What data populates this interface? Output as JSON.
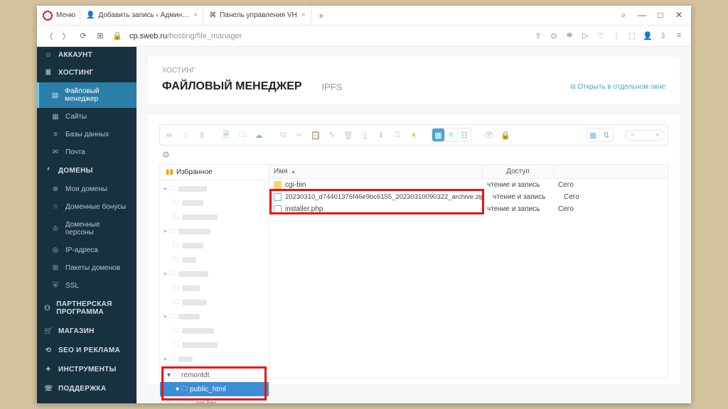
{
  "browser": {
    "menu": "Меню",
    "tabs": [
      {
        "label": "Добавить запись ‹ Админ…"
      },
      {
        "label": "Панель управления VH"
      }
    ],
    "url_host": "cp.sweb.ru",
    "url_path": "/hosting/file_manager"
  },
  "sidebar": {
    "account": "АККАУНТ",
    "hosting": "ХОСТИНГ",
    "items_hosting": [
      {
        "icon": "▤",
        "label": "Файловый менеджер",
        "active": true
      },
      {
        "icon": "▦",
        "label": "Сайты"
      },
      {
        "icon": "≡",
        "label": "Базы данных"
      },
      {
        "icon": "✉",
        "label": "Почта"
      }
    ],
    "domains": "ДОМЕНЫ",
    "items_domains": [
      {
        "icon": "⊕",
        "label": "Мои домены"
      },
      {
        "icon": "☆",
        "label": "Доменные бонусы"
      },
      {
        "icon": "♔",
        "label": "Доменные персоны"
      },
      {
        "icon": "◎",
        "label": "IP-адреса"
      },
      {
        "icon": "⊞",
        "label": "Пакеты доменов"
      },
      {
        "icon": "⛨",
        "label": "SSL"
      }
    ],
    "partner": "ПАРТНЕРСКАЯ ПРОГРАММА",
    "shop": "МАГАЗИН",
    "seo": "SEO И РЕКЛАМА",
    "tools": "ИНСТРУМЕНТЫ",
    "support": "ПОДДЕРЖКА"
  },
  "header": {
    "breadcrumb": "ХОСТИНГ",
    "title": "ФАЙЛОВЫЙ МЕНЕДЖЕР",
    "tab2": "IPFS",
    "open": "Открыть в отдельном окне"
  },
  "tree": {
    "favorites": "Избранное",
    "node_parent": "remontdt",
    "node_sel": "public_html",
    "node_child": "cgi-bin"
  },
  "table": {
    "col_name": "Имя",
    "col_access": "Доступ",
    "col_date": "",
    "rows": [
      {
        "type": "folder",
        "name": "cgi-bin",
        "access": "чтение и запись",
        "date": "Сего"
      },
      {
        "type": "file",
        "name": "20230310_d74401376f46e9bc6155_20230310090322_archive.zip",
        "access": "чтение и запись",
        "date": "Сего"
      },
      {
        "type": "file",
        "name": "installer.php",
        "access": "чтение и запись",
        "date": "Сего"
      }
    ]
  }
}
